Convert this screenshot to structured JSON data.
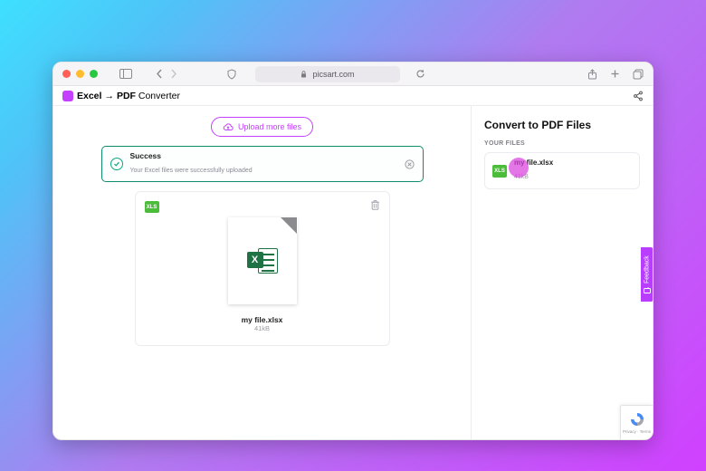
{
  "browser": {
    "url_host": "picsart.com"
  },
  "app": {
    "title_bold1": "Excel",
    "title_arrow": "→",
    "title_bold2": "PDF",
    "title_rest": "Converter"
  },
  "main": {
    "upload_label": "Upload more files",
    "alert": {
      "title": "Success",
      "message": "Your Excel files were successfully uploaded"
    },
    "file": {
      "badge": "XLS",
      "icon_letter": "X",
      "name": "my file.xlsx",
      "size": "41kB"
    }
  },
  "side": {
    "title": "Convert to PDF Files",
    "subtitle": "YOUR FILES",
    "file": {
      "badge": "XLS",
      "name": "my file.xlsx",
      "size": "41kB"
    }
  },
  "feedback": {
    "label": "Feedback"
  },
  "recaptcha": {
    "line": "Privacy · Terms"
  }
}
